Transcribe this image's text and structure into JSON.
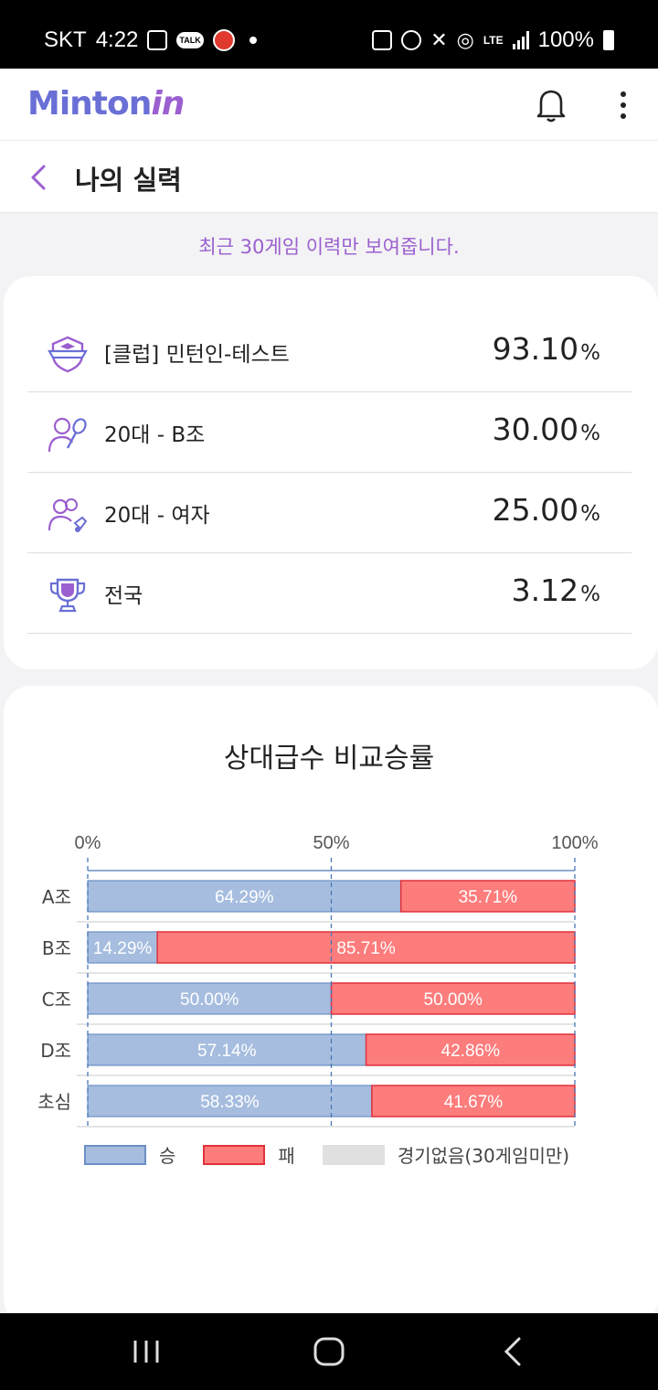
{
  "status_bar": {
    "carrier": "SKT",
    "time": "4:22",
    "talk_badge": "TALK",
    "network": "LTE",
    "battery": "100%"
  },
  "app": {
    "logo_main": "Minton",
    "logo_accent": "in"
  },
  "header": {
    "title": "나의 실력"
  },
  "notice": "최근 30게임 이력만 보여줍니다.",
  "rankings": [
    {
      "icon": "club-shield-icon",
      "label": "[클럽] 민턴인-테스트",
      "value": "93.10",
      "unit": "%"
    },
    {
      "icon": "player-badminton-icon",
      "label": "20대 - B조",
      "value": "30.00",
      "unit": "%"
    },
    {
      "icon": "players-shuttlecock-icon",
      "label": "20대 - 여자",
      "value": "25.00",
      "unit": "%"
    },
    {
      "icon": "trophy-icon",
      "label": "전국",
      "value": "3.12",
      "unit": "%"
    }
  ],
  "colors": {
    "accent": "#9b5fcf",
    "logo": "#6a6fd6",
    "win": "#a6bddf",
    "win_border": "#6b8fc4",
    "loss": "#fd7c7c",
    "loss_border": "#e0323c",
    "no_game": "#e0e0e0"
  },
  "chart_data": {
    "type": "bar",
    "stacked": true,
    "orientation": "horizontal",
    "title": "상대급수 비교승률",
    "categories": [
      "A조",
      "B조",
      "C조",
      "D조",
      "초심"
    ],
    "series": [
      {
        "name": "승",
        "values": [
          64.29,
          14.29,
          50.0,
          57.14,
          58.33
        ]
      },
      {
        "name": "패",
        "values": [
          35.71,
          85.71,
          50.0,
          42.86,
          41.67
        ]
      }
    ],
    "data_labels_win": [
      "64.29%",
      "14.29%",
      "50.00%",
      "57.14%",
      "58.33%"
    ],
    "data_labels_loss": [
      "35.71%",
      "85.71%",
      "50.00%",
      "42.86%",
      "41.67%"
    ],
    "xticks": [
      "0%",
      "50%",
      "100%"
    ],
    "xlim": [
      0,
      100
    ],
    "legend": [
      "승",
      "패",
      "경기없음(30게임미만)"
    ],
    "legend_position": "bottom"
  }
}
